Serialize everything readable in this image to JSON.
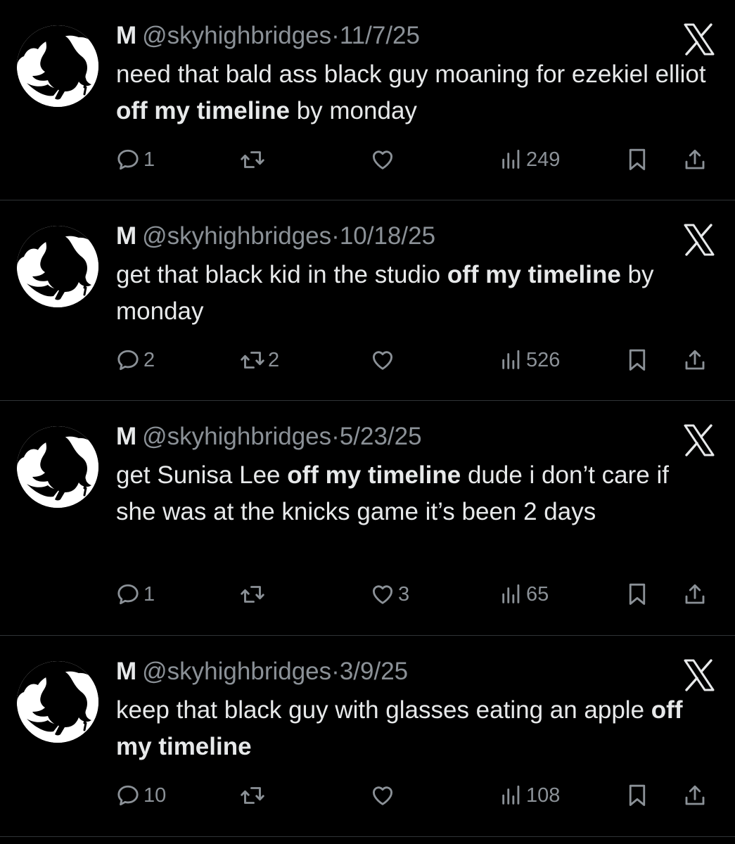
{
  "colors": {
    "background": "#000000",
    "primary_text": "#e7e9ea",
    "secondary_text": "#8b9197",
    "divider": "#2f3336"
  },
  "icons": {
    "reply": "reply-icon",
    "retweet": "retweet-icon",
    "like": "heart-icon",
    "views": "views-bar-icon",
    "bookmark": "bookmark-icon",
    "share": "share-icon",
    "brand": "x-logo-icon"
  },
  "tweets": [
    {
      "name": "M",
      "handle": "@skyhighbridges",
      "separator": "·",
      "date": "11/7/25",
      "text_before": "need that bald ass black guy moaning for ezekiel elliot ",
      "text_bold": "off my timeline",
      "text_after": " by monday",
      "replies": "1",
      "retweets": "",
      "likes": "",
      "views": "249"
    },
    {
      "name": "M",
      "handle": "@skyhighbridges",
      "separator": "·",
      "date": "10/18/25",
      "text_before": "get that black kid in the studio ",
      "text_bold": "off my timeline",
      "text_after": " by monday",
      "replies": "2",
      "retweets": "2",
      "likes": "",
      "views": "526"
    },
    {
      "name": "M",
      "handle": "@skyhighbridges",
      "separator": "·",
      "date": "5/23/25",
      "text_before": "get Sunisa Lee ",
      "text_bold": "off my timeline",
      "text_after": " dude i don’t care if she was at the knicks game it’s been 2 days",
      "replies": "1",
      "retweets": "",
      "likes": "3",
      "views": "65"
    },
    {
      "name": "M",
      "handle": "@skyhighbridges",
      "separator": "·",
      "date": "3/9/25",
      "text_before": "keep that black guy with glasses eating an apple ",
      "text_bold": "off my timeline",
      "text_after": "",
      "replies": "10",
      "retweets": "",
      "likes": "",
      "views": "108"
    }
  ]
}
